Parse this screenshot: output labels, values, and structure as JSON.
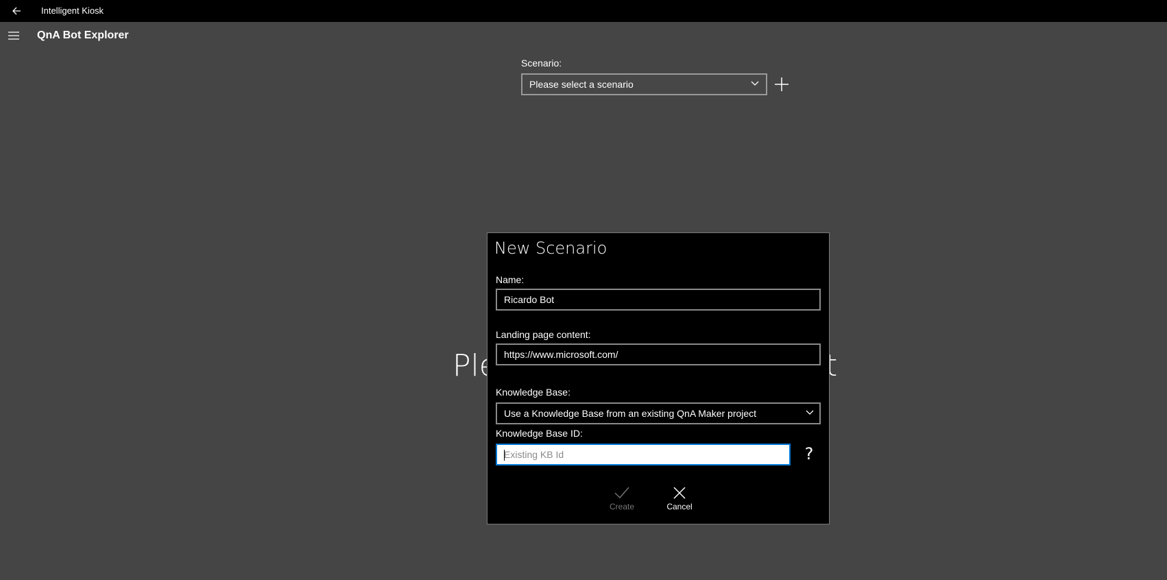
{
  "app": {
    "title": "Intelligent Kiosk",
    "page_title": "QnA Bot Explorer"
  },
  "scenario": {
    "label": "Scenario:",
    "selected": "Please select a scenario"
  },
  "background_message": {
    "visible_left": "Ple",
    "visible_right": "art"
  },
  "dialog": {
    "title": "New Scenario",
    "name_label": "Name:",
    "name_value": "Ricardo Bot",
    "landing_label": "Landing page content:",
    "landing_value": "https://www.microsoft.com/",
    "kb_label": "Knowledge Base:",
    "kb_selected": "Use a Knowledge Base from an existing QnA Maker project",
    "kb_id_label": "Knowledge Base ID:",
    "kb_id_placeholder": "Existing KB Id",
    "help_glyph": "?",
    "create_label": "Create",
    "cancel_label": "Cancel"
  },
  "colors": {
    "background": "#454545",
    "titlebar": "#000000",
    "dialog": "#000000",
    "accent_focus": "#0078d7",
    "disabled": "#777777"
  },
  "icons": [
    "back-arrow-icon",
    "hamburger-menu-icon",
    "chevron-down-icon",
    "plus-icon",
    "checkmark-icon",
    "close-icon"
  ]
}
